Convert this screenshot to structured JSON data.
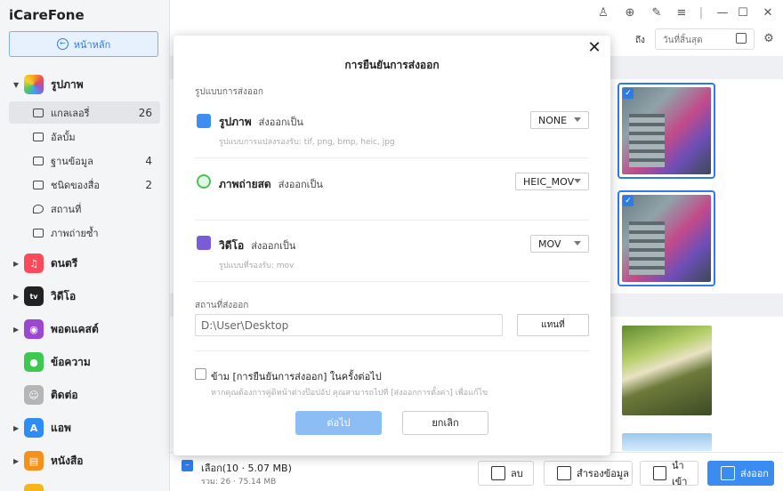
{
  "app": {
    "title": "iCareFone"
  },
  "sidebar": {
    "home_label": "หน้าหลัก",
    "categories": [
      {
        "label": "รูปภาพ",
        "icon": "photos-icon",
        "color": "#f6a12a"
      },
      {
        "label": "ดนตรี",
        "icon": "music-icon",
        "color": "#fb4a5c"
      },
      {
        "label": "วิดีโอ",
        "icon": "tv-icon",
        "color": "#222222"
      },
      {
        "label": "พอดแคสต์",
        "icon": "podcast-icon",
        "color": "#9b47d0"
      },
      {
        "label": "ข้อความ",
        "icon": "messages-icon",
        "color": "#3dc94f"
      },
      {
        "label": "ติดต่อ",
        "icon": "contacts-icon",
        "color": "#b5b5b5"
      },
      {
        "label": "แอพ",
        "icon": "appstore-icon",
        "color": "#2e8df5"
      },
      {
        "label": "หนังสือ",
        "icon": "books-icon",
        "color": "#f5901b"
      }
    ],
    "sub_items": [
      {
        "label": "แกลเลอรี่",
        "count": "26"
      },
      {
        "label": "อัลบั้ม",
        "count": ""
      },
      {
        "label": "ฐานข้อมูล",
        "count": "4"
      },
      {
        "label": "ชนิดของสื่อ",
        "count": "2"
      },
      {
        "label": "สถานที่",
        "count": ""
      },
      {
        "label": "ภาพถ่ายซ้ำ",
        "count": ""
      }
    ]
  },
  "toolbar": {
    "to_label": "ถึง",
    "end_date_placeholder": "วันที่สิ้นสุด"
  },
  "dialog": {
    "title": "การยืนยันการส่งออก",
    "format_section": "รูปแบบการส่งออก",
    "items": [
      {
        "name": "รูปภาพ",
        "as": "ส่งออกเป็น",
        "note": "รูปแบบการแปลงรองรับ: tif, png, bmp, heic, jpg",
        "format": "NONE"
      },
      {
        "name": "ภาพถ่ายสด",
        "as": "ส่งออกเป็น",
        "note": "",
        "format": "HEIC_MOV"
      },
      {
        "name": "วิดีโอ",
        "as": "ส่งออกเป็น",
        "note": "รูปแบบที่รองรับ: mov",
        "format": "MOV"
      }
    ],
    "location_label": "สถานที่ส่งออก",
    "path_value": "D:\\User\\Desktop",
    "browse_label": "แทนที่",
    "skip_label": "ข้าม [การยืนยันการส่งออก] ในครั้งต่อไป",
    "skip_note": "หากคุณต้องการคู่ดิหน้าต่างป๊อปอัป คุณสามารถไปที่ [ส่งออกการตั้งค่า] เพื่อแก้ไข",
    "next_label": "ต่อไป",
    "cancel_label": "ยกเลิก"
  },
  "bottom": {
    "selected": "เลือก(10 · 5.07 MB)",
    "total": "รวม: 26 · 75.14 MB",
    "delete_label": "ลบ",
    "backup_label": "สำรองข้อมูล",
    "import_label": "นำเข้า",
    "export_label": "ส่งออก"
  },
  "colors": {
    "accent": "#2f7be6",
    "primary_btn": "#3a8cf0"
  }
}
